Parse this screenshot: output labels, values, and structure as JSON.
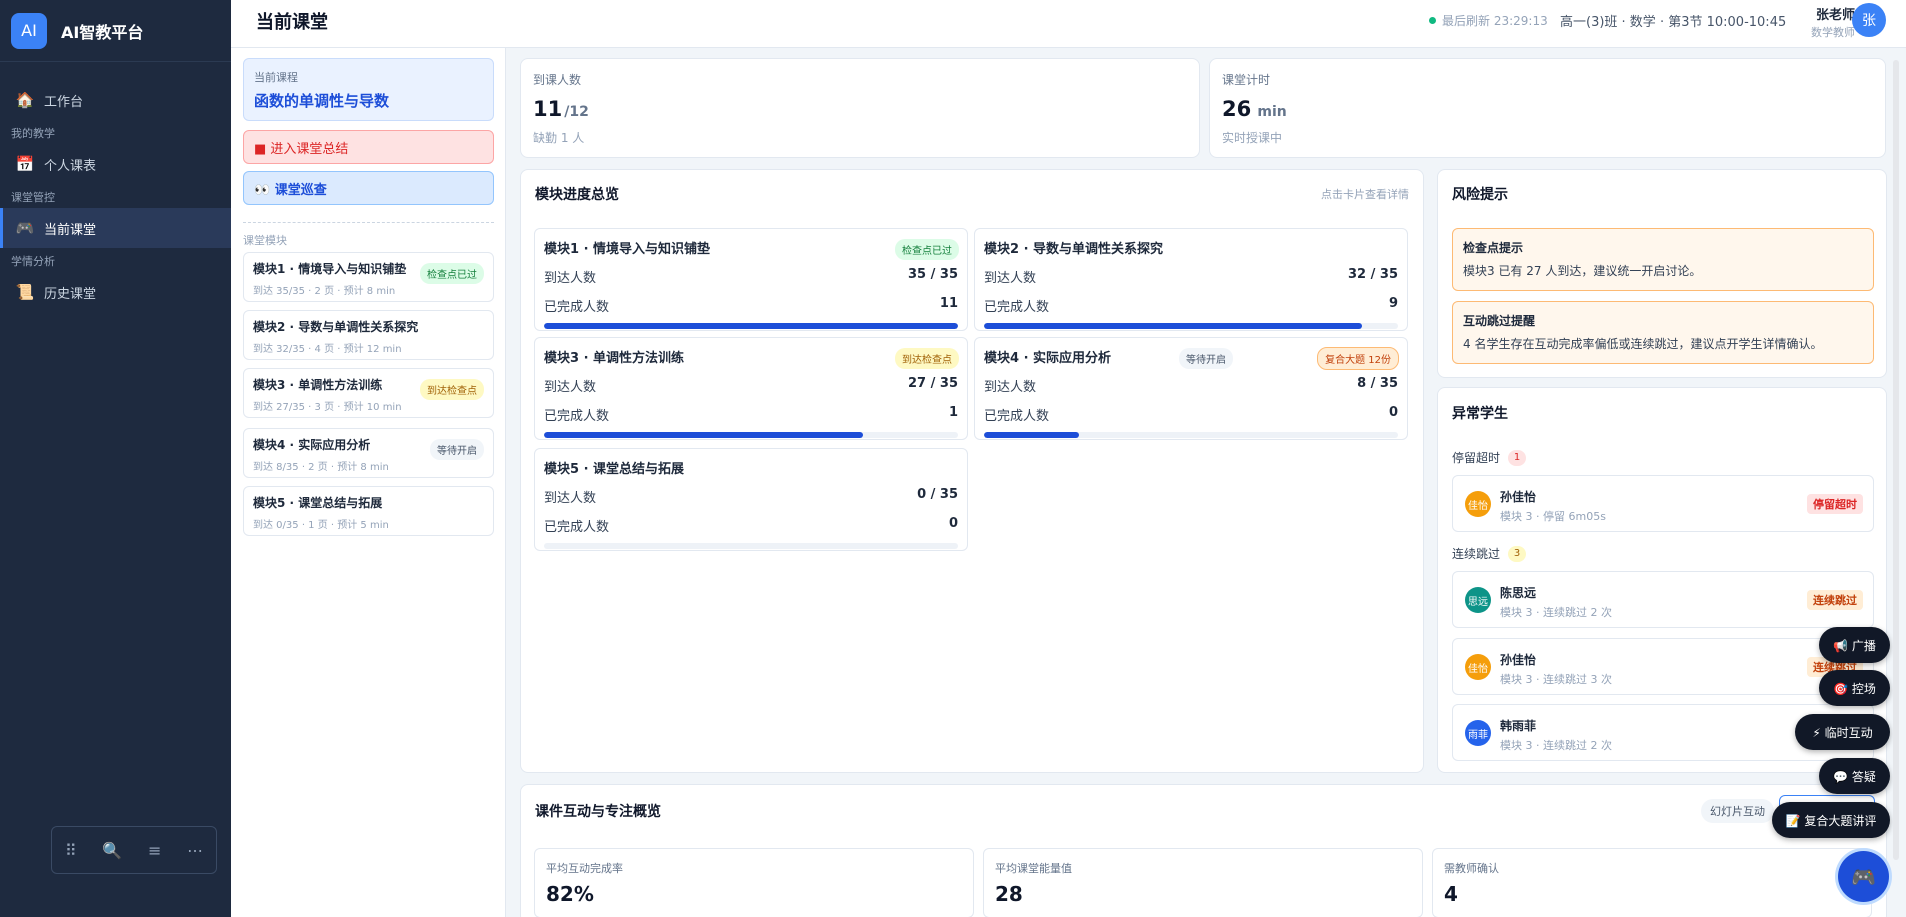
{
  "brand": {
    "logo": "AI",
    "name": "AI智教平台"
  },
  "nav": {
    "workbench": {
      "icon": "🏠",
      "label": "工作台"
    },
    "group_my": "我的教学",
    "schedule": {
      "icon": "📅",
      "label": "个人课表"
    },
    "group_class": "课堂管控",
    "current": {
      "icon": "🎮",
      "label": "当前课堂"
    },
    "group_analysis": "学情分析",
    "history": {
      "icon": "📜",
      "label": "历史课堂"
    }
  },
  "sidebar_toolbar": {
    "drag": "⠿",
    "search": "🔍",
    "menu": "≡",
    "more": "⋯"
  },
  "header": {
    "title": "当前课堂",
    "refresh": "最后刷新 23:29:13",
    "classinfo": "高一(3)班 · 数学 · 第3节 10:00-10:45",
    "teacher_name": "张老师",
    "teacher_role": "数学教师",
    "avatar": "张"
  },
  "left": {
    "course_label": "当前课程",
    "course_name": "函数的单调性与导数",
    "summary_btn": "■ 进入课堂总结",
    "patrol_btn": "👀 课堂巡查",
    "section_label": "课堂模块",
    "modules": [
      {
        "title": "模块1 · 情境导入与知识铺垫",
        "sub": "到达 35/35 · 2 页 · 预计 8 min",
        "badge": "检查点已过"
      },
      {
        "title": "模块2 · 导数与单调性关系探究",
        "sub": "到达 32/35 · 4 页 · 预计 12 min",
        "badge": ""
      },
      {
        "title": "模块3 · 单调性方法训练",
        "sub": "到达 27/35 · 3 页 · 预计 10 min",
        "badge": "到达检查点"
      },
      {
        "title": "模块4 · 实际应用分析",
        "sub": "到达 8/35 · 2 页 · 预计 8 min",
        "badge": "等待开启"
      },
      {
        "title": "模块5 · 课堂总结与拓展",
        "sub": "到达 0/35 · 1 页 · 预计 5 min",
        "badge": ""
      }
    ]
  },
  "stats": {
    "attendance": {
      "label": "到课人数",
      "value": "11",
      "total": "/12",
      "foot": "缺勤 1 人"
    },
    "timer": {
      "label": "课堂计时",
      "value": "26",
      "unit": "min",
      "foot": "实时授课中"
    }
  },
  "progress": {
    "title": "模块进度总览",
    "hint": "点击卡片查看详情",
    "arrived_label": "到达人数",
    "completed_label": "已完成人数",
    "cards": [
      {
        "title": "模块1 · 情境导入与知识铺垫",
        "arrived": "35 / 35",
        "completed": "11",
        "progress": 1.0,
        "badge": "检查点已过",
        "badge2": ""
      },
      {
        "title": "模块2 · 导数与单调性关系探究",
        "arrived": "32 / 35",
        "completed": "9",
        "progress": 0.914,
        "badge": "",
        "badge2": ""
      },
      {
        "title": "模块3 · 单调性方法训练",
        "arrived": "27 / 35",
        "completed": "1",
        "progress": 0.771,
        "badge": "到达检查点",
        "badge2": ""
      },
      {
        "title": "模块4 · 实际应用分析",
        "arrived": "8 / 35",
        "completed": "0",
        "progress": 0.229,
        "badge": "等待开启",
        "badge2": "复合大题 12份"
      },
      {
        "title": "模块5 · 课堂总结与拓展",
        "arrived": "0 / 35",
        "completed": "0",
        "progress": 0.0,
        "badge": "",
        "badge2": ""
      }
    ]
  },
  "risk": {
    "title": "风险提示",
    "items": [
      {
        "title": "检查点提示",
        "desc": "模块3 已有 27 人到达，建议统一开启讨论。"
      },
      {
        "title": "互动跳过提醒",
        "desc": "4 名学生存在互动完成率偏低或连续跳过，建议点开学生详情确认。"
      }
    ]
  },
  "abnormal": {
    "title": "异常学生",
    "group_stay": {
      "label": "停留超时",
      "count": "1"
    },
    "group_skip": {
      "label": "连续跳过",
      "count": "3"
    },
    "students": [
      {
        "avatar": "佳怡",
        "name": "孙佳怡",
        "desc": "模块 3 · 停留 6m05s",
        "tag": "停留超时",
        "color": "#f59e0b"
      },
      {
        "avatar": "思远",
        "name": "陈思远",
        "desc": "模块 3 · 连续跳过 2 次",
        "tag": "连续跳过",
        "color": "#0d9488"
      },
      {
        "avatar": "佳怡",
        "name": "孙佳怡",
        "desc": "模块 3 · 连续跳过 3 次",
        "tag": "连续跳过",
        "color": "#f59e0b"
      },
      {
        "avatar": "雨菲",
        "name": "韩雨菲",
        "desc": "模块 3 · 连续跳过 2 次",
        "tag": "",
        "color": "#2563eb"
      }
    ]
  },
  "interaction": {
    "title": "课件互动与专注概览",
    "tab_slides": "幻灯片互动",
    "kpis": [
      {
        "label": "平均互动完成率",
        "value": "82%"
      },
      {
        "label": "平均课堂能量值",
        "value": "28"
      },
      {
        "label": "需教师确认",
        "value": "4"
      }
    ]
  },
  "fabs": {
    "broadcast": "📢 广播",
    "control": "🎯 控场",
    "interact": "⚡ 临时互动",
    "qa": "💬 答疑",
    "review": "📝 复合大题讲评",
    "main_icon": "🎮"
  }
}
